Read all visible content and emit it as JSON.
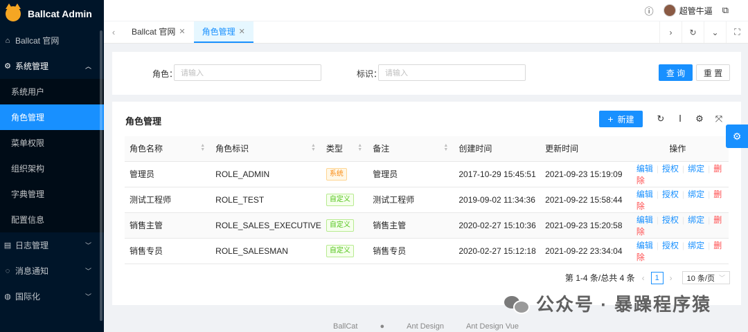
{
  "app": {
    "title": "Ballcat Admin"
  },
  "sidebar": {
    "items": [
      {
        "label": "Ballcat 官网",
        "icon": "home-icon"
      },
      {
        "label": "系统管理",
        "icon": "gear-icon",
        "open": true,
        "children": [
          "系统用户",
          "角色管理",
          "菜单权限",
          "组织架构",
          "字典管理",
          "配置信息"
        ],
        "active_child": "角色管理"
      },
      {
        "label": "日志管理",
        "icon": "log-icon"
      },
      {
        "label": "消息通知",
        "icon": "message-icon"
      },
      {
        "label": "国际化",
        "icon": "globe-icon"
      }
    ]
  },
  "header": {
    "user_name": "超管牛逼"
  },
  "tabs": [
    {
      "label": "Ballcat 官网",
      "active": false
    },
    {
      "label": "角色管理",
      "active": true
    }
  ],
  "search": {
    "role_label": "角色：",
    "role_placeholder": "请输入",
    "code_label": "标识：",
    "code_placeholder": "请输入",
    "query_button": "查 询",
    "reset_button": "重 置"
  },
  "card": {
    "title": "角色管理",
    "new_button": "新建"
  },
  "table": {
    "columns": [
      "角色名称",
      "角色标识",
      "类型",
      "备注",
      "创建时间",
      "更新时间",
      "操作"
    ],
    "rows": [
      {
        "name": "管理员",
        "code": "ROLE_ADMIN",
        "type": "系统",
        "remark": "管理员",
        "created": "2017-10-29 15:45:51",
        "updated": "2021-09-23 15:19:09"
      },
      {
        "name": "测试工程师",
        "code": "ROLE_TEST",
        "type": "自定义",
        "remark": "测试工程师",
        "created": "2019-09-02 11:34:36",
        "updated": "2021-09-22 15:58:44"
      },
      {
        "name": "销售主管",
        "code": "ROLE_SALES_EXECUTIVE",
        "type": "自定义",
        "remark": "销售主管",
        "created": "2020-02-27 15:10:36",
        "updated": "2021-09-23 15:20:58"
      },
      {
        "name": "销售专员",
        "code": "ROLE_SALESMAN",
        "type": "自定义",
        "remark": "销售专员",
        "created": "2020-02-27 15:12:18",
        "updated": "2021-09-22 23:34:04"
      }
    ],
    "actions": [
      "编辑",
      "授权",
      "绑定",
      "删除"
    ]
  },
  "pagination": {
    "summary": "第 1-4 条/总共 4 条",
    "current": "1",
    "page_size": "10 条/页"
  },
  "footer": {
    "links": [
      "BallCat",
      "Ant Design",
      "Ant Design Vue"
    ]
  },
  "watermark": {
    "text": "公众号 · 暴躁程序猿"
  },
  "colors": {
    "primary": "#1890ff",
    "sider": "#001529",
    "danger": "#ff4d4f",
    "tag_system": "#fa8c16",
    "tag_custom": "#52c41a"
  }
}
